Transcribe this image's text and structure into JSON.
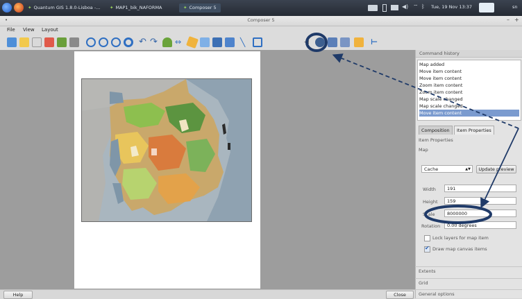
{
  "taskbar": {
    "tasks": [
      "Quantum GIS 1.8.0-Lisboa -...",
      "MAP1_bik_NAFORMA",
      "Composer 5"
    ],
    "clock": "Tue, 19 Nov 13:37",
    "user": "sn"
  },
  "window": {
    "title": "Composer 5",
    "min_glyph": "–",
    "max_glyph": "+"
  },
  "menubar": {
    "file": "File",
    "view": "View",
    "layout": "Layout"
  },
  "command_history": {
    "header": "Command history",
    "items": [
      "Map added",
      "Move item content",
      "Move item content",
      "Zoom item content",
      "Zoom item content",
      "Map scale changed",
      "Map scale changed",
      "Move item content"
    ],
    "selected_index": 7
  },
  "tabs": {
    "composition": "Composition",
    "item_properties": "Item Properties"
  },
  "item_props": {
    "header": "Item Properties",
    "map_label": "Map",
    "cache_select": "Cache",
    "update_preview": "Update preview",
    "width_label": "Width",
    "width_value": "191",
    "height_label": "Height",
    "height_value": "159",
    "scale_label": "Scale",
    "scale_value": "8000000",
    "rotation_label": "Rotation",
    "rotation_value": "0.00 degrees",
    "lock_layers": "Lock layers for map item",
    "draw_canvas": "Draw map canvas items",
    "lock_checked": false,
    "draw_checked": true
  },
  "sections": [
    "Extents",
    "Grid",
    "General options"
  ],
  "statusbar": {
    "help": "Help",
    "close": "Close"
  },
  "colors": {
    "annotation": "#1f3a68",
    "selection": "#7b9bcf",
    "canvas": "#9d9d9d",
    "ocean": "#98a7b3"
  }
}
